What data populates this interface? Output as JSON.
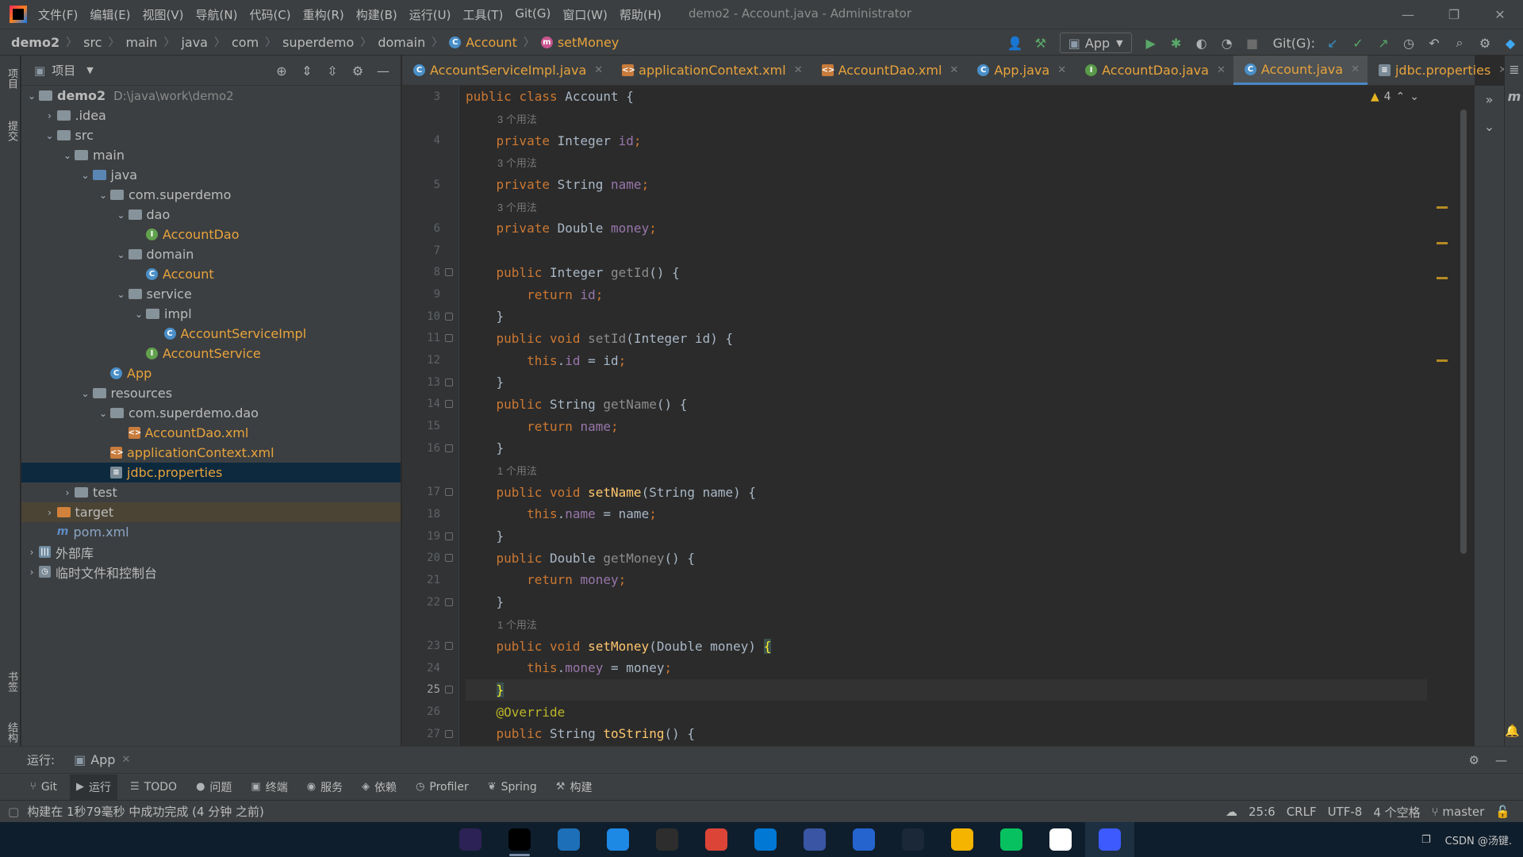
{
  "menubar": {
    "items": [
      "文件(F)",
      "编辑(E)",
      "视图(V)",
      "导航(N)",
      "代码(C)",
      "重构(R)",
      "构建(B)",
      "运行(U)",
      "工具(T)",
      "Git(G)",
      "窗口(W)",
      "帮助(H)"
    ],
    "window_title": "demo2 - Account.java - Administrator"
  },
  "breadcrumb": [
    "demo2",
    "src",
    "main",
    "java",
    "com",
    "superdemo",
    "domain",
    "Account",
    "setMoney"
  ],
  "toolbar": {
    "run_config": "App",
    "git_label": "Git(G):"
  },
  "left_stripe": {
    "top_label": "项目",
    "mid_label": "提交",
    "bookmark_label": "书签",
    "structure_label": "结构"
  },
  "project": {
    "title": "项目",
    "rows": [
      {
        "indent": 0,
        "arrow": "v",
        "icon": "folder",
        "name": "demo2",
        "bold": true,
        "path": "D:\\java\\work\\demo2"
      },
      {
        "indent": 1,
        "arrow": ">",
        "icon": "folder",
        "name": ".idea"
      },
      {
        "indent": 1,
        "arrow": "v",
        "icon": "folder",
        "name": "src"
      },
      {
        "indent": 2,
        "arrow": "v",
        "icon": "folder",
        "name": "main"
      },
      {
        "indent": 3,
        "arrow": "v",
        "icon": "folder-blue",
        "name": "java"
      },
      {
        "indent": 4,
        "arrow": "v",
        "icon": "pkg",
        "name": "com.superdemo"
      },
      {
        "indent": 5,
        "arrow": "v",
        "icon": "pkg",
        "name": "dao"
      },
      {
        "indent": 6,
        "arrow": "",
        "icon": "interface",
        "name": "AccountDao",
        "orange": true
      },
      {
        "indent": 5,
        "arrow": "v",
        "icon": "pkg",
        "name": "domain"
      },
      {
        "indent": 6,
        "arrow": "",
        "icon": "class",
        "name": "Account",
        "orange": true
      },
      {
        "indent": 5,
        "arrow": "v",
        "icon": "pkg",
        "name": "service"
      },
      {
        "indent": 6,
        "arrow": "v",
        "icon": "pkg",
        "name": "impl"
      },
      {
        "indent": 7,
        "arrow": "",
        "icon": "class",
        "name": "AccountServiceImpl",
        "orange": true
      },
      {
        "indent": 6,
        "arrow": "",
        "icon": "interface",
        "name": "AccountService",
        "orange": true
      },
      {
        "indent": 4,
        "arrow": "",
        "icon": "class",
        "name": "App",
        "orange": true
      },
      {
        "indent": 3,
        "arrow": "v",
        "icon": "res",
        "name": "resources"
      },
      {
        "indent": 4,
        "arrow": "v",
        "icon": "pkg",
        "name": "com.superdemo.dao"
      },
      {
        "indent": 5,
        "arrow": "",
        "icon": "xml",
        "name": "AccountDao.xml",
        "orange": true
      },
      {
        "indent": 4,
        "arrow": "",
        "icon": "xml",
        "name": "applicationContext.xml",
        "orange": true
      },
      {
        "indent": 4,
        "arrow": "",
        "icon": "prop",
        "name": "jdbc.properties",
        "orange": true,
        "selected": true
      },
      {
        "indent": 2,
        "arrow": ">",
        "icon": "folder",
        "name": "test"
      },
      {
        "indent": 1,
        "arrow": ">",
        "icon": "folder-orange",
        "name": "target",
        "excluded": true
      },
      {
        "indent": 1,
        "arrow": "",
        "icon": "maven",
        "name": "pom.xml",
        "muted": true
      },
      {
        "indent": 0,
        "arrow": ">",
        "icon": "lib",
        "name": "外部库"
      },
      {
        "indent": 0,
        "arrow": ">",
        "icon": "scratch",
        "name": "临时文件和控制台"
      }
    ]
  },
  "tabs": [
    {
      "label": "AccountServiceImpl.java",
      "icon": "c"
    },
    {
      "label": "applicationContext.xml",
      "icon": "xml"
    },
    {
      "label": "AccountDao.xml",
      "icon": "xml"
    },
    {
      "label": "App.java",
      "icon": "c"
    },
    {
      "label": "AccountDao.java",
      "icon": "i"
    },
    {
      "label": "Account.java",
      "icon": "c",
      "active": true
    },
    {
      "label": "jdbc.properties",
      "icon": "prop"
    }
  ],
  "editor": {
    "warning_count": "4",
    "lines": [
      {
        "n": "3",
        "tokens": [
          [
            "kw",
            "public "
          ],
          [
            "kw",
            "class "
          ],
          [
            "plain",
            "Account {"
          ]
        ]
      },
      {
        "n": "",
        "hint": "3 个用法"
      },
      {
        "n": "4",
        "tokens": [
          [
            "plain",
            "    "
          ],
          [
            "kw",
            "private "
          ],
          [
            "plain",
            "Integer "
          ],
          [
            "fld",
            "id"
          ],
          [
            "kw",
            ";"
          ]
        ]
      },
      {
        "n": "",
        "hint": "3 个用法"
      },
      {
        "n": "5",
        "tokens": [
          [
            "plain",
            "    "
          ],
          [
            "kw",
            "private "
          ],
          [
            "plain",
            "String "
          ],
          [
            "fld",
            "name"
          ],
          [
            "kw",
            ";"
          ]
        ]
      },
      {
        "n": "",
        "hint": "3 个用法"
      },
      {
        "n": "6",
        "tokens": [
          [
            "plain",
            "    "
          ],
          [
            "kw",
            "private "
          ],
          [
            "plain",
            "Double "
          ],
          [
            "fld",
            "money"
          ],
          [
            "kw",
            ";"
          ]
        ]
      },
      {
        "n": "7",
        "tokens": []
      },
      {
        "n": "8",
        "fold": true,
        "tokens": [
          [
            "plain",
            "    "
          ],
          [
            "kw",
            "public "
          ],
          [
            "plain",
            "Integer "
          ],
          [
            "mth-gray",
            "getId"
          ],
          [
            "plain",
            "() {"
          ]
        ]
      },
      {
        "n": "9",
        "tokens": [
          [
            "plain",
            "        "
          ],
          [
            "kw",
            "return "
          ],
          [
            "fld",
            "id"
          ],
          [
            "kw",
            ";"
          ]
        ]
      },
      {
        "n": "10",
        "fold": true,
        "tokens": [
          [
            "plain",
            "    }"
          ]
        ]
      },
      {
        "n": "11",
        "fold": true,
        "tokens": [
          [
            "plain",
            "    "
          ],
          [
            "kw",
            "public void "
          ],
          [
            "mth-gray",
            "setId"
          ],
          [
            "plain",
            "(Integer id) {"
          ]
        ]
      },
      {
        "n": "12",
        "tokens": [
          [
            "plain",
            "        "
          ],
          [
            "kw",
            "this"
          ],
          [
            "plain",
            "."
          ],
          [
            "fld",
            "id"
          ],
          [
            "plain",
            " = id"
          ],
          [
            "kw",
            ";"
          ]
        ]
      },
      {
        "n": "13",
        "fold": true,
        "tokens": [
          [
            "plain",
            "    }"
          ]
        ]
      },
      {
        "n": "14",
        "fold": true,
        "tokens": [
          [
            "plain",
            "    "
          ],
          [
            "kw",
            "public "
          ],
          [
            "plain",
            "String "
          ],
          [
            "mth-gray",
            "getName"
          ],
          [
            "plain",
            "() {"
          ]
        ]
      },
      {
        "n": "15",
        "tokens": [
          [
            "plain",
            "        "
          ],
          [
            "kw",
            "return "
          ],
          [
            "fld",
            "name"
          ],
          [
            "kw",
            ";"
          ]
        ]
      },
      {
        "n": "16",
        "fold": true,
        "tokens": [
          [
            "plain",
            "    }"
          ]
        ]
      },
      {
        "n": "",
        "hint": "1 个用法"
      },
      {
        "n": "17",
        "fold": true,
        "tokens": [
          [
            "plain",
            "    "
          ],
          [
            "kw",
            "public void "
          ],
          [
            "mth",
            "setName"
          ],
          [
            "plain",
            "(String name) {"
          ]
        ]
      },
      {
        "n": "18",
        "tokens": [
          [
            "plain",
            "        "
          ],
          [
            "kw",
            "this"
          ],
          [
            "plain",
            "."
          ],
          [
            "fld",
            "name"
          ],
          [
            "plain",
            " = name"
          ],
          [
            "kw",
            ";"
          ]
        ]
      },
      {
        "n": "19",
        "fold": true,
        "tokens": [
          [
            "plain",
            "    }"
          ]
        ]
      },
      {
        "n": "20",
        "fold": true,
        "tokens": [
          [
            "plain",
            "    "
          ],
          [
            "kw",
            "public "
          ],
          [
            "plain",
            "Double "
          ],
          [
            "mth-gray",
            "getMoney"
          ],
          [
            "plain",
            "() {"
          ]
        ]
      },
      {
        "n": "21",
        "tokens": [
          [
            "plain",
            "        "
          ],
          [
            "kw",
            "return "
          ],
          [
            "fld",
            "money"
          ],
          [
            "kw",
            ";"
          ]
        ]
      },
      {
        "n": "22",
        "fold": true,
        "tokens": [
          [
            "plain",
            "    }"
          ]
        ]
      },
      {
        "n": "",
        "hint": "1 个用法"
      },
      {
        "n": "23",
        "fold": true,
        "tokens": [
          [
            "plain",
            "    "
          ],
          [
            "kw",
            "public void "
          ],
          [
            "mth",
            "setMoney"
          ],
          [
            "plain",
            "(Double money) "
          ],
          [
            "brace-hl",
            "{"
          ]
        ]
      },
      {
        "n": "24",
        "tokens": [
          [
            "plain",
            "        "
          ],
          [
            "kw",
            "this"
          ],
          [
            "plain",
            "."
          ],
          [
            "fld",
            "money"
          ],
          [
            "plain",
            " = money"
          ],
          [
            "kw",
            ";"
          ]
        ]
      },
      {
        "n": "25",
        "fold": true,
        "current": true,
        "tokens": [
          [
            "plain",
            "    "
          ],
          [
            "brace-hl",
            "}"
          ]
        ]
      },
      {
        "n": "26",
        "tokens": [
          [
            "plain",
            "    "
          ],
          [
            "ann",
            "@Override"
          ]
        ]
      },
      {
        "n": "27",
        "fold": true,
        "tokens": [
          [
            "plain",
            "    "
          ],
          [
            "kw",
            "public "
          ],
          [
            "plain",
            "String "
          ],
          [
            "mth",
            "toString"
          ],
          [
            "plain",
            "() {"
          ]
        ]
      }
    ]
  },
  "run_panel": {
    "label": "运行:",
    "tab": "App"
  },
  "tool_windows": [
    {
      "glyph": "⑂",
      "label": "Git"
    },
    {
      "glyph": "▶",
      "label": "运行",
      "active": true
    },
    {
      "glyph": "☰",
      "label": "TODO"
    },
    {
      "glyph": "●",
      "label": "问题"
    },
    {
      "glyph": "▣",
      "label": "终端"
    },
    {
      "glyph": "◉",
      "label": "服务"
    },
    {
      "glyph": "◈",
      "label": "依赖"
    },
    {
      "glyph": "◷",
      "label": "Profiler"
    },
    {
      "glyph": "❦",
      "label": "Spring"
    },
    {
      "glyph": "⚒",
      "label": "构建"
    }
  ],
  "status": {
    "message": "构建在 1秒79毫秒 中成功完成 (4 分钟 之前)",
    "position": "25:6",
    "line_sep": "CRLF",
    "encoding": "UTF-8",
    "indent": "4 个空格",
    "branch": "master"
  },
  "taskbar": {
    "apps": [
      {
        "name": "eclipse",
        "color": "#2c2255"
      },
      {
        "name": "intellij",
        "color": "#000000",
        "open": true
      },
      {
        "name": "edge-dev",
        "color": "#1d6fb8"
      },
      {
        "name": "remote",
        "color": "#1e88e5"
      },
      {
        "name": "terminal",
        "color": "#2d2d2d"
      },
      {
        "name": "chrome",
        "color": "#db4437"
      },
      {
        "name": "vscode",
        "color": "#0078d4"
      },
      {
        "name": "visio",
        "color": "#3955a3"
      },
      {
        "name": "todo",
        "color": "#2564cf"
      },
      {
        "name": "steam",
        "color": "#1b2838"
      },
      {
        "name": "explorer",
        "color": "#f4b400"
      },
      {
        "name": "wechat",
        "color": "#07c160"
      },
      {
        "name": "game",
        "color": "#ffffff"
      },
      {
        "name": "player",
        "color": "#3d5afe",
        "active": true
      }
    ],
    "tray_text": "CSDN @汤键."
  }
}
